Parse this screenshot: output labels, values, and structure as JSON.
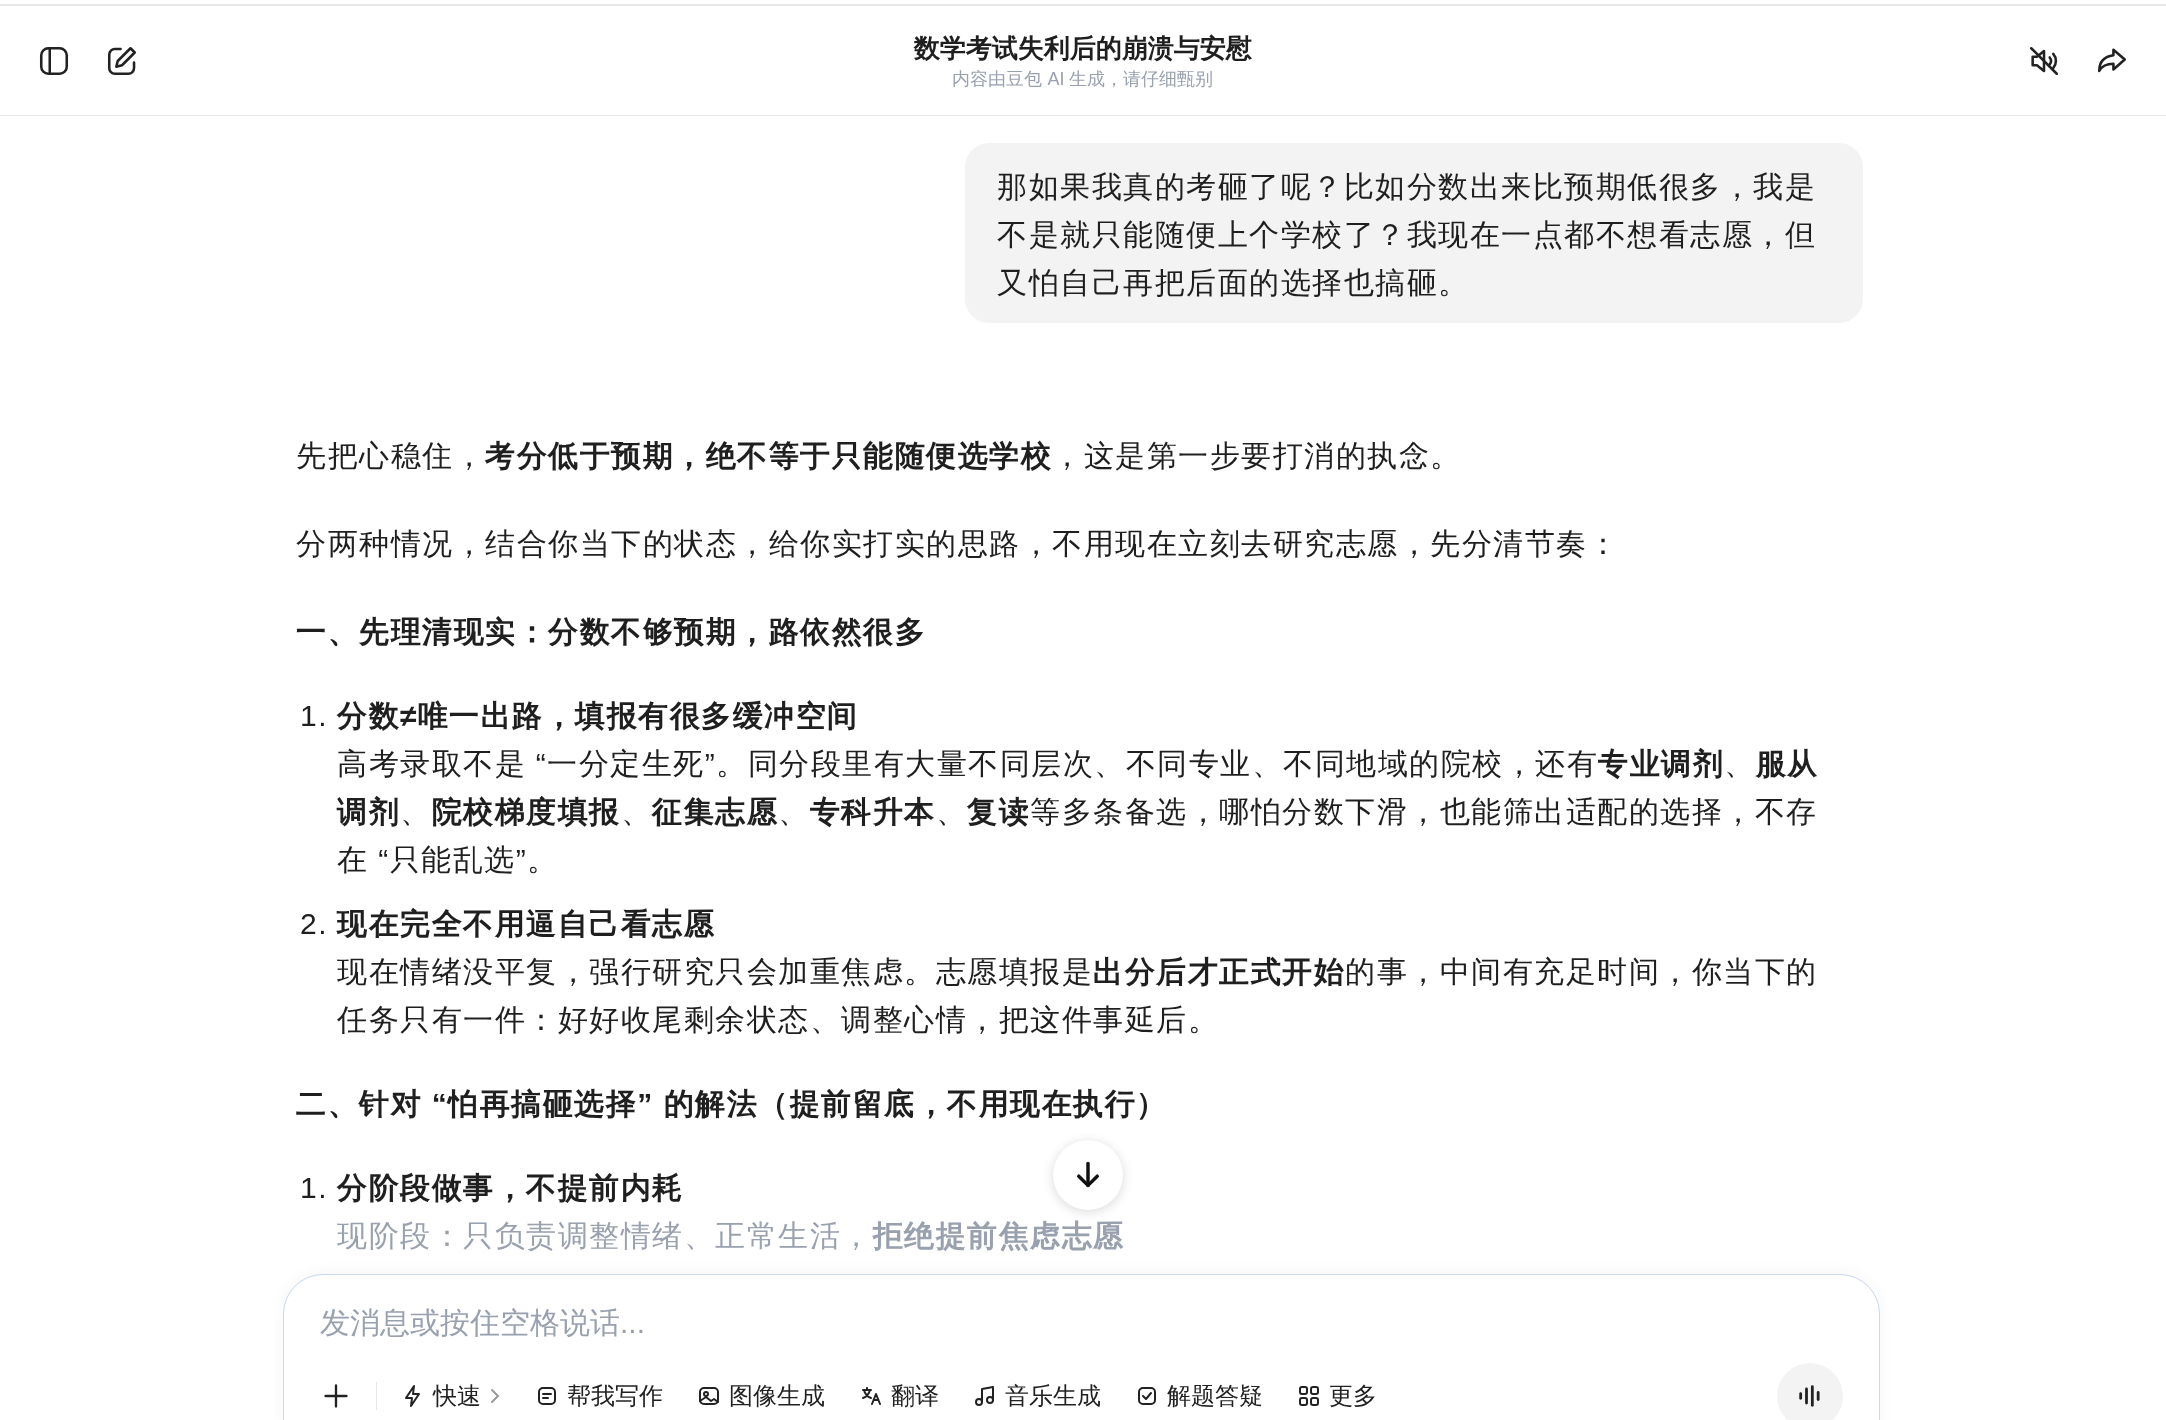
{
  "header": {
    "title": "数学考试失利后的崩溃与安慰",
    "subtitle": "内容由豆包 AI 生成，请仔细甄别"
  },
  "user_message": "那如果我真的考砸了呢？比如分数出来比预期低很多，我是不是就只能随便上个学校了？我现在一点都不想看志愿，但又怕自己再把后面的选择也搞砸。",
  "answer": [
    {
      "kind": "paragraph",
      "text": "先把心稳住，**考分低于预期，绝不等于只能随便选学校**，这是第一步要打消的执念。"
    },
    {
      "kind": "paragraph",
      "text": "分两种情况，结合你当下的状态，给你实打实的思路，不用现在立刻去研究志愿，先分清节奏："
    },
    {
      "kind": "heading",
      "text": "一、先理清现实：分数不够预期，路依然很多"
    },
    {
      "kind": "list_item",
      "number": "1.",
      "title": "分数≠唯一出路，填报有很多缓冲空间",
      "text": "高考录取不是 “一分定生死”。同分段里有大量不同层次、不同专业、不同地域的院校，还有**专业调剂**、**服从调剂**、**院校梯度填报**、**征集志愿**、**专科升本**、**复读**等多条备选，哪怕分数下滑，也能筛出适配的选择，不存在 “只能乱选”。"
    },
    {
      "kind": "list_item",
      "number": "2.",
      "title": "现在完全不用逼自己看志愿",
      "text": "现在情绪没平复，强行研究只会加重焦虑。志愿填报是**出分后才正式开始**的事，中间有充足时间，你当下的任务只有一件：好好收尾剩余状态、调整心情，把这件事延后。"
    },
    {
      "kind": "heading",
      "text": "二、针对 “怕再搞砸选择” 的解法（提前留底，不用现在执行）"
    },
    {
      "kind": "list_item",
      "number": "1.",
      "title": "分阶段做事，不提前内耗",
      "text": "现阶段：只负责调整情绪、正常生活，**拒绝提前焦虑志愿**"
    }
  ],
  "input": {
    "placeholder": "发消息或按住空格说话..."
  },
  "tools": [
    {
      "kind": "dropdown",
      "label": "快速"
    },
    {
      "kind": "tool",
      "label": "帮我写作"
    },
    {
      "kind": "tool",
      "label": "图像生成"
    },
    {
      "kind": "tool",
      "label": "翻译"
    },
    {
      "kind": "tool",
      "label": "音乐生成"
    },
    {
      "kind": "tool",
      "label": "解题答疑"
    },
    {
      "kind": "tool",
      "label": "更多"
    }
  ]
}
